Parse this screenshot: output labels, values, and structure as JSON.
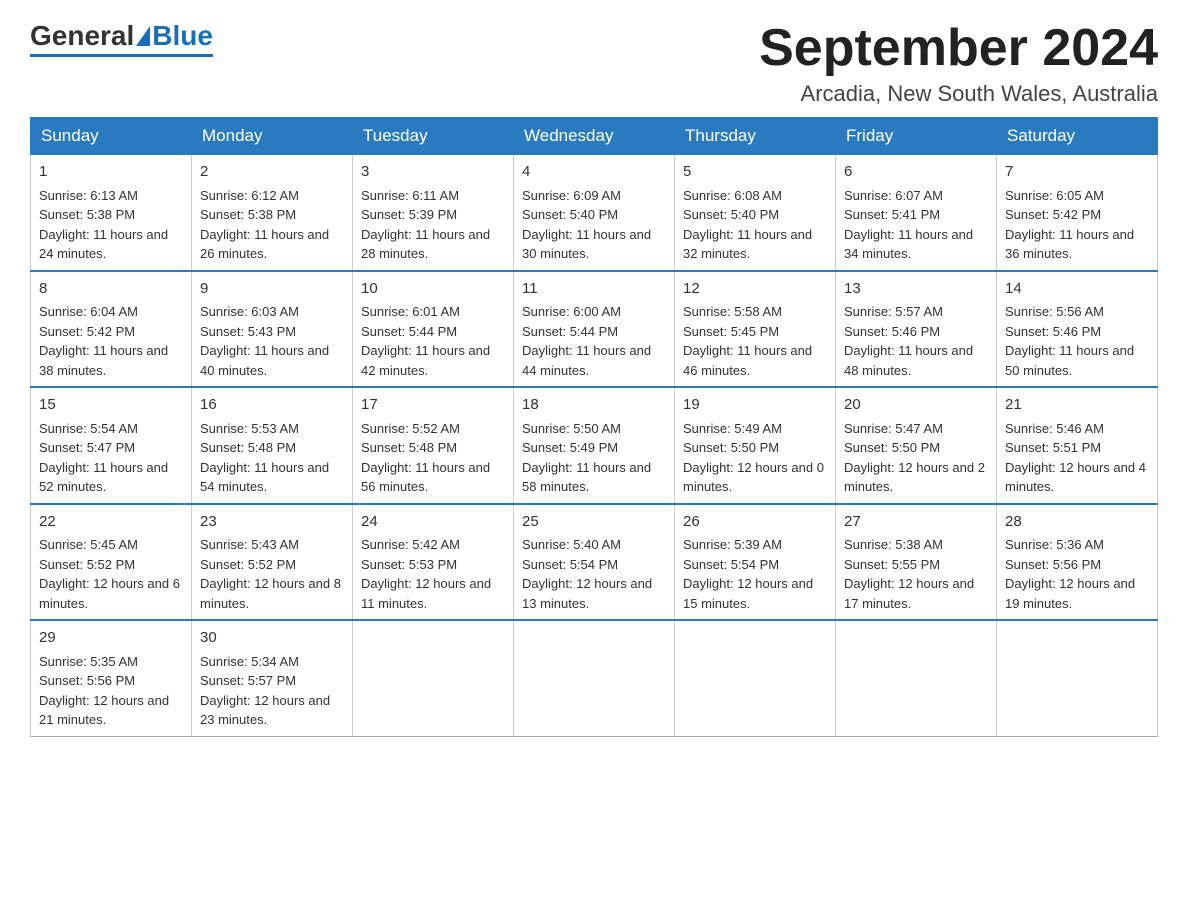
{
  "header": {
    "logo_general": "General",
    "logo_blue": "Blue",
    "month_title": "September 2024",
    "location": "Arcadia, New South Wales, Australia"
  },
  "days_of_week": [
    "Sunday",
    "Monday",
    "Tuesday",
    "Wednesday",
    "Thursday",
    "Friday",
    "Saturday"
  ],
  "weeks": [
    [
      {
        "day": "1",
        "sunrise": "6:13 AM",
        "sunset": "5:38 PM",
        "daylight": "11 hours and 24 minutes."
      },
      {
        "day": "2",
        "sunrise": "6:12 AM",
        "sunset": "5:38 PM",
        "daylight": "11 hours and 26 minutes."
      },
      {
        "day": "3",
        "sunrise": "6:11 AM",
        "sunset": "5:39 PM",
        "daylight": "11 hours and 28 minutes."
      },
      {
        "day": "4",
        "sunrise": "6:09 AM",
        "sunset": "5:40 PM",
        "daylight": "11 hours and 30 minutes."
      },
      {
        "day": "5",
        "sunrise": "6:08 AM",
        "sunset": "5:40 PM",
        "daylight": "11 hours and 32 minutes."
      },
      {
        "day": "6",
        "sunrise": "6:07 AM",
        "sunset": "5:41 PM",
        "daylight": "11 hours and 34 minutes."
      },
      {
        "day": "7",
        "sunrise": "6:05 AM",
        "sunset": "5:42 PM",
        "daylight": "11 hours and 36 minutes."
      }
    ],
    [
      {
        "day": "8",
        "sunrise": "6:04 AM",
        "sunset": "5:42 PM",
        "daylight": "11 hours and 38 minutes."
      },
      {
        "day": "9",
        "sunrise": "6:03 AM",
        "sunset": "5:43 PM",
        "daylight": "11 hours and 40 minutes."
      },
      {
        "day": "10",
        "sunrise": "6:01 AM",
        "sunset": "5:44 PM",
        "daylight": "11 hours and 42 minutes."
      },
      {
        "day": "11",
        "sunrise": "6:00 AM",
        "sunset": "5:44 PM",
        "daylight": "11 hours and 44 minutes."
      },
      {
        "day": "12",
        "sunrise": "5:58 AM",
        "sunset": "5:45 PM",
        "daylight": "11 hours and 46 minutes."
      },
      {
        "day": "13",
        "sunrise": "5:57 AM",
        "sunset": "5:46 PM",
        "daylight": "11 hours and 48 minutes."
      },
      {
        "day": "14",
        "sunrise": "5:56 AM",
        "sunset": "5:46 PM",
        "daylight": "11 hours and 50 minutes."
      }
    ],
    [
      {
        "day": "15",
        "sunrise": "5:54 AM",
        "sunset": "5:47 PM",
        "daylight": "11 hours and 52 minutes."
      },
      {
        "day": "16",
        "sunrise": "5:53 AM",
        "sunset": "5:48 PM",
        "daylight": "11 hours and 54 minutes."
      },
      {
        "day": "17",
        "sunrise": "5:52 AM",
        "sunset": "5:48 PM",
        "daylight": "11 hours and 56 minutes."
      },
      {
        "day": "18",
        "sunrise": "5:50 AM",
        "sunset": "5:49 PM",
        "daylight": "11 hours and 58 minutes."
      },
      {
        "day": "19",
        "sunrise": "5:49 AM",
        "sunset": "5:50 PM",
        "daylight": "12 hours and 0 minutes."
      },
      {
        "day": "20",
        "sunrise": "5:47 AM",
        "sunset": "5:50 PM",
        "daylight": "12 hours and 2 minutes."
      },
      {
        "day": "21",
        "sunrise": "5:46 AM",
        "sunset": "5:51 PM",
        "daylight": "12 hours and 4 minutes."
      }
    ],
    [
      {
        "day": "22",
        "sunrise": "5:45 AM",
        "sunset": "5:52 PM",
        "daylight": "12 hours and 6 minutes."
      },
      {
        "day": "23",
        "sunrise": "5:43 AM",
        "sunset": "5:52 PM",
        "daylight": "12 hours and 8 minutes."
      },
      {
        "day": "24",
        "sunrise": "5:42 AM",
        "sunset": "5:53 PM",
        "daylight": "12 hours and 11 minutes."
      },
      {
        "day": "25",
        "sunrise": "5:40 AM",
        "sunset": "5:54 PM",
        "daylight": "12 hours and 13 minutes."
      },
      {
        "day": "26",
        "sunrise": "5:39 AM",
        "sunset": "5:54 PM",
        "daylight": "12 hours and 15 minutes."
      },
      {
        "day": "27",
        "sunrise": "5:38 AM",
        "sunset": "5:55 PM",
        "daylight": "12 hours and 17 minutes."
      },
      {
        "day": "28",
        "sunrise": "5:36 AM",
        "sunset": "5:56 PM",
        "daylight": "12 hours and 19 minutes."
      }
    ],
    [
      {
        "day": "29",
        "sunrise": "5:35 AM",
        "sunset": "5:56 PM",
        "daylight": "12 hours and 21 minutes."
      },
      {
        "day": "30",
        "sunrise": "5:34 AM",
        "sunset": "5:57 PM",
        "daylight": "12 hours and 23 minutes."
      },
      null,
      null,
      null,
      null,
      null
    ]
  ],
  "labels": {
    "sunrise": "Sunrise:",
    "sunset": "Sunset:",
    "daylight": "Daylight:"
  }
}
